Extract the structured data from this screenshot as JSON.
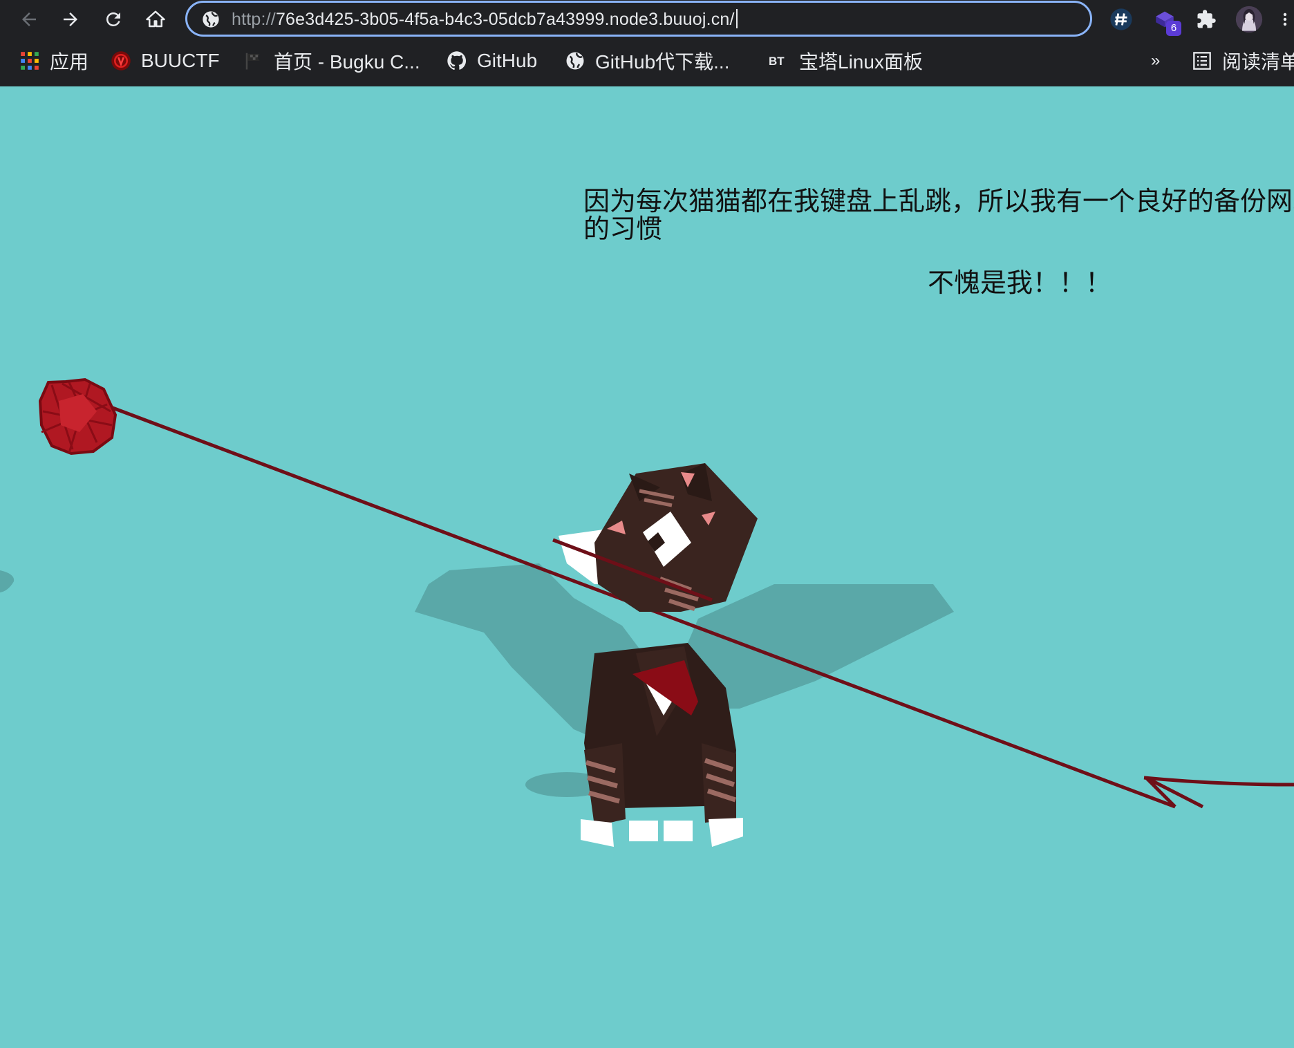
{
  "browser": {
    "url_scheme": "http://",
    "url_rest": "76e3d425-3b05-4f5a-b4c3-05dcb7a43999.node3.buuoj.cn/",
    "extension_badge": "6"
  },
  "bookmarks": [
    {
      "label": "应用",
      "icon": "apps-grid-icon"
    },
    {
      "label": "BUUCTF",
      "icon": "buuctf-logo-icon"
    },
    {
      "label": "首页 - Bugku C...",
      "icon": "flag-icon"
    },
    {
      "label": "GitHub",
      "icon": "github-icon"
    },
    {
      "label": "GitHub代下载...",
      "icon": "globe-icon"
    },
    {
      "label": "宝塔Linux面板",
      "icon": "bt-icon"
    }
  ],
  "bookmarks_overflow": "»",
  "reading_list": "阅读清单",
  "page": {
    "message": "因为每次猫猫都在我键盘上乱跳，所以我有一个良好的备份网站的习惯",
    "exclaim": "不愧是我！！！"
  },
  "colors": {
    "background": "#6ecccc",
    "cat_body": "#3a241f",
    "yarn": "#b01822",
    "string": "#6e0f18"
  }
}
